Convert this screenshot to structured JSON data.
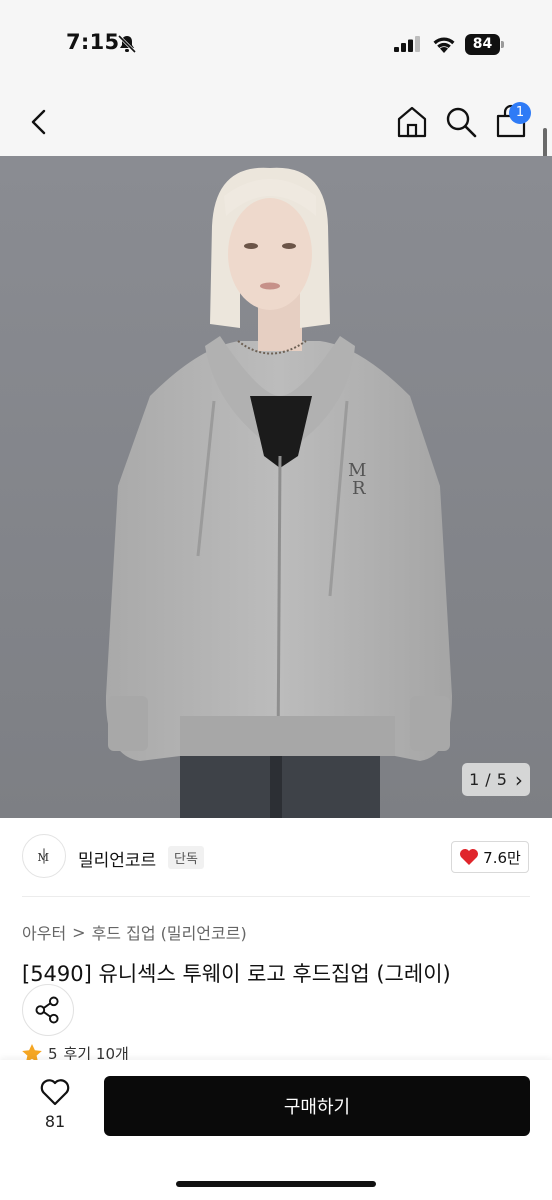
{
  "status_bar": {
    "time": "7:15",
    "battery": "84"
  },
  "nav": {
    "cart_badge": "1"
  },
  "gallery": {
    "current": "1",
    "separator": "/",
    "total": "5",
    "next_glyph": "›"
  },
  "seller": {
    "name": "밀리언코르",
    "badge": "단독",
    "likes": "7.6만"
  },
  "breadcrumb": {
    "parent": "아우터",
    "separator": ">",
    "current": "후드 집업 (밀리언코르)"
  },
  "product": {
    "title": "[5490] 유니섹스 투웨이 로고 후드집업 (그레이)"
  },
  "rating": {
    "score": "5",
    "reviews": "후기 10개"
  },
  "bottom_bar": {
    "wish_count": "81",
    "buy_label": "구매하기"
  },
  "colors": {
    "accent_blue": "#2f7bf6",
    "heart_red": "#e0252b",
    "star_orange": "#f5a623",
    "buy_bg": "#0a0a0a"
  }
}
